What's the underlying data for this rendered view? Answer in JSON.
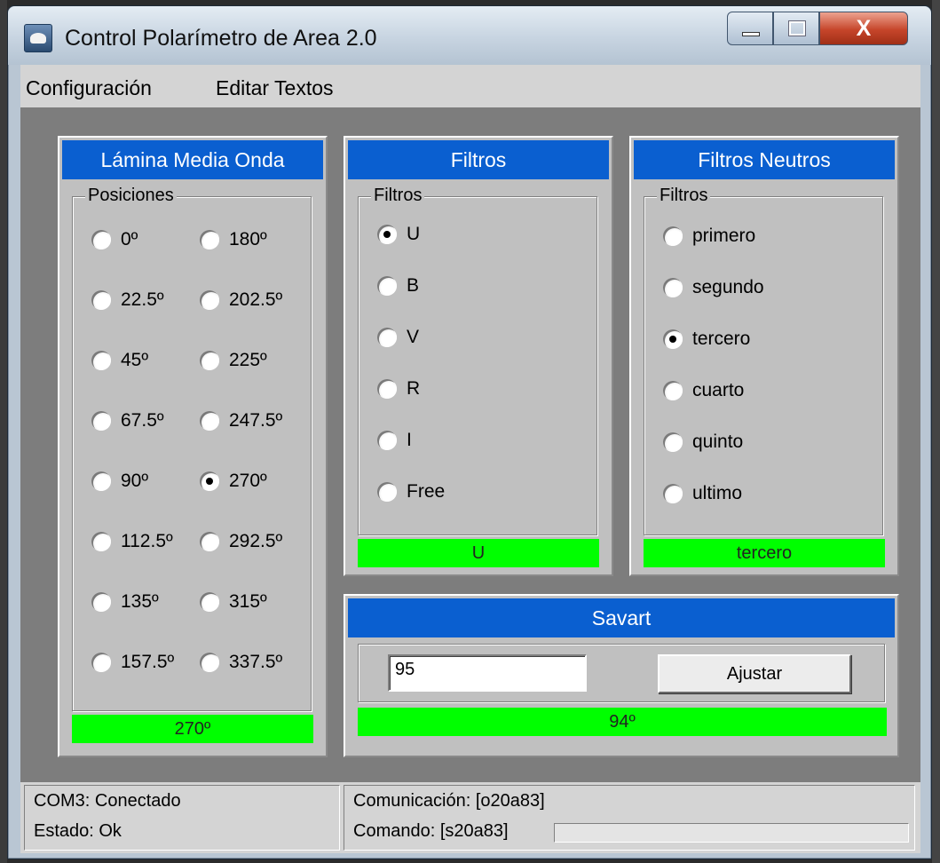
{
  "window": {
    "title": "Control Polarímetro de Area 2.0",
    "close_glyph": "X"
  },
  "menu": {
    "items": [
      "Configuración",
      "Editar Textos"
    ]
  },
  "half_wave": {
    "title": "Lámina Media Onda",
    "group_label": "Posiciones",
    "options_left": [
      "0º",
      "22.5º",
      "45º",
      "67.5º",
      "90º",
      "112.5º",
      "135º",
      "157.5º"
    ],
    "options_right": [
      "180º",
      "202.5º",
      "225º",
      "247.5º",
      "270º",
      "292.5º",
      "315º",
      "337.5º"
    ],
    "selected": "270º",
    "status": "270º"
  },
  "filters": {
    "title": "Filtros",
    "group_label": "Filtros",
    "options": [
      "U",
      "B",
      "V",
      "R",
      "I",
      "Free"
    ],
    "selected": "U",
    "status": "U"
  },
  "neutral_filters": {
    "title": "Filtros Neutros",
    "group_label": "Filtros",
    "options": [
      "primero",
      "segundo",
      "tercero",
      "cuarto",
      "quinto",
      "ultimo"
    ],
    "selected": "tercero",
    "status": "tercero"
  },
  "savart": {
    "title": "Savart",
    "input_value": "95",
    "adjust_label": "Ajustar",
    "status": "94º"
  },
  "footer": {
    "port_status": "COM3: Conectado",
    "state": "Estado: Ok",
    "communication": "Comunicación: [o20a83]",
    "command": "Comando: [s20a83]",
    "progress": 0
  },
  "colors": {
    "panel_header": "#0a5fd0",
    "status_green": "#00ff00",
    "panel_bg": "#c0c0c0",
    "client_bg": "#7d7d7d"
  }
}
